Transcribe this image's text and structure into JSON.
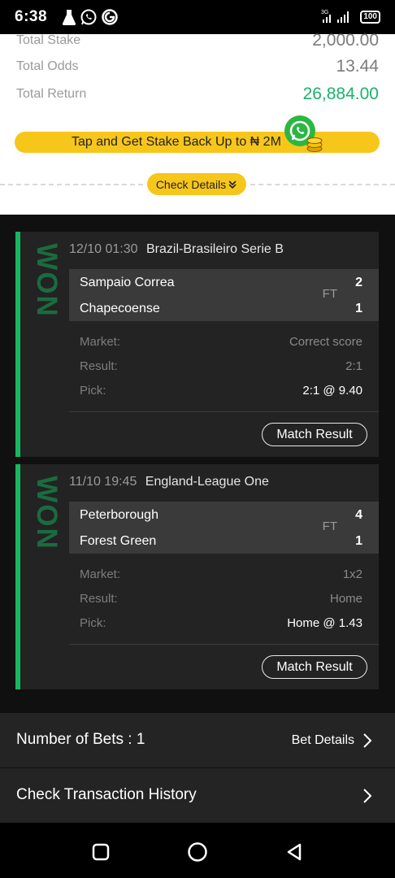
{
  "status_bar": {
    "time": "6:38",
    "network": "3G",
    "battery": "100",
    "icons": [
      "flask-icon",
      "whatsapp-icon",
      "app-logo-icon",
      "signal-icon",
      "battery-icon"
    ]
  },
  "summary": {
    "total_stake_label": "Total Stake",
    "total_stake_value": "2,000.00",
    "total_odds_label": "Total Odds",
    "total_odds_value": "13.44",
    "total_return_label": "Total Return",
    "total_return_value": "26,884.00",
    "promo_text": "Tap and Get Stake Back Up to ₦ 2M",
    "check_details_label": "Check Details"
  },
  "bets": [
    {
      "status": "WON",
      "datetime": "12/10 01:30",
      "league": "Brazil-Brasileiro Serie B",
      "home_team": "Sampaio Correa",
      "away_team": "Chapecoense",
      "home_score": "2",
      "away_score": "1",
      "match_status": "FT",
      "market_label": "Market:",
      "market_value": "Correct score",
      "result_label": "Result:",
      "result_value": "2:1",
      "pick_label": "Pick:",
      "pick_value": "2:1 @ 9.40",
      "match_result_label": "Match Result"
    },
    {
      "status": "WON",
      "datetime": "11/10 19:45",
      "league": "England-League One",
      "home_team": "Peterborough",
      "away_team": "Forest Green",
      "home_score": "4",
      "away_score": "1",
      "match_status": "FT",
      "market_label": "Market:",
      "market_value": "1x2",
      "result_label": "Result:",
      "result_value": "Home",
      "pick_label": "Pick:",
      "pick_value": "Home @ 1.43",
      "match_result_label": "Match Result"
    }
  ],
  "footer": {
    "number_of_bets_label": "Number of Bets :",
    "number_of_bets_value": "1",
    "bet_details_label": "Bet Details",
    "transaction_history_label": "Check Transaction History"
  },
  "colors": {
    "accent_yellow": "#f7c61b",
    "win_green": "#17b75f",
    "return_green": "#1ab36b"
  }
}
